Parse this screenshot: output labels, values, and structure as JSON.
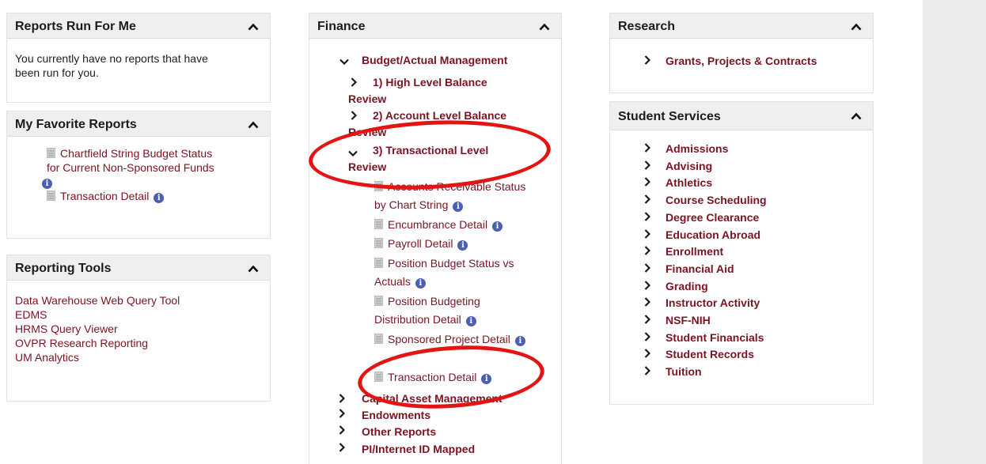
{
  "reports_run": {
    "title": "Reports Run For Me",
    "message_line1": "You currently have no reports that have",
    "message_line2": "been run for you."
  },
  "favorites": {
    "title": "My Favorite Reports",
    "item1_line1": "Chartfield String Budget Status",
    "item1_line2": "for Current Non-Sponsored Funds",
    "item2": "Transaction Detail"
  },
  "reporting_tools": {
    "title": "Reporting Tools",
    "links": [
      "Data Warehouse Web Query Tool",
      "EDMS",
      "HRMS Query Viewer",
      "OVPR Research Reporting",
      "UM Analytics"
    ]
  },
  "finance": {
    "title": "Finance",
    "budget_actual": "Budget/Actual Management",
    "high_level_line1": "1) High Level Balance",
    "high_level_line2": "Review",
    "account_level_line1": "2) Account Level Balance",
    "account_level_line2": "Review",
    "transactional_line1": "3) Transactional Level",
    "transactional_line2": "Review",
    "reports": {
      "ar_line1": "Accounts Receivable Status",
      "ar_line2": "by Chart String",
      "encumbrance": "Encumbrance Detail",
      "payroll": "Payroll Detail",
      "position_budget_line1": "Position Budget Status vs",
      "position_budget_line2": "Actuals",
      "position_budgeting_line1": "Position Budgeting",
      "position_budgeting_line2": "Distribution Detail",
      "sponsored": "Sponsored Project Detail",
      "transaction": "Transaction Detail"
    },
    "bottom_links": [
      "Capital Asset Management",
      "Endowments",
      "Other Reports",
      "PI/Internet ID Mapped"
    ]
  },
  "research": {
    "title": "Research",
    "links": [
      "Grants, Projects & Contracts"
    ]
  },
  "student_services": {
    "title": "Student Services",
    "links": [
      "Admissions",
      "Advising",
      "Athletics",
      "Course Scheduling",
      "Degree Clearance",
      "Education Abroad",
      "Enrollment",
      "Financial Aid",
      "Grading",
      "Instructor Activity",
      "NSF-NIH",
      "Student Financials",
      "Student Records",
      "Tuition"
    ]
  },
  "icons": {
    "info": "info-icon",
    "document": "document-icon",
    "chevron_right": "chevron-right-icon",
    "chevron_down": "chevron-down-icon",
    "collapse": "chevron-up-icon"
  },
  "colors": {
    "link": "#7a1423",
    "header_bg": "#efefef",
    "annotation": "#e31414",
    "info_badge": "#4a5fb5"
  }
}
